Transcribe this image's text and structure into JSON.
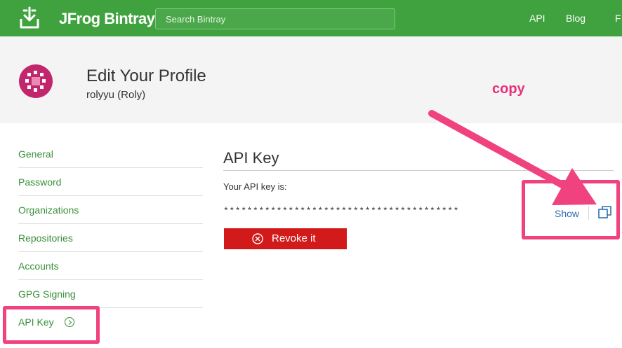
{
  "topbar": {
    "brand": "JFrog Bintray",
    "search_placeholder": "Search Bintray",
    "links": [
      "API",
      "Blog",
      "F"
    ]
  },
  "profile": {
    "title": "Edit Your Profile",
    "username": "rolyyu (Roly)"
  },
  "sidebar": {
    "items": [
      {
        "label": "General"
      },
      {
        "label": "Password"
      },
      {
        "label": "Organizations"
      },
      {
        "label": "Repositories"
      },
      {
        "label": "Accounts"
      },
      {
        "label": "GPG Signing"
      },
      {
        "label": "API Key",
        "active": true
      }
    ]
  },
  "api_key": {
    "title": "API Key",
    "label": "Your API key is:",
    "masked": "****************************************",
    "show_label": "Show",
    "revoke_label": "Revoke it"
  },
  "annotation": {
    "note": "copy",
    "color": "#f0427f"
  },
  "colors": {
    "brand_green": "#3fa23f",
    "link_green": "#3a8f3a",
    "danger_red": "#d21a1a",
    "avatar": "#c2266d"
  }
}
